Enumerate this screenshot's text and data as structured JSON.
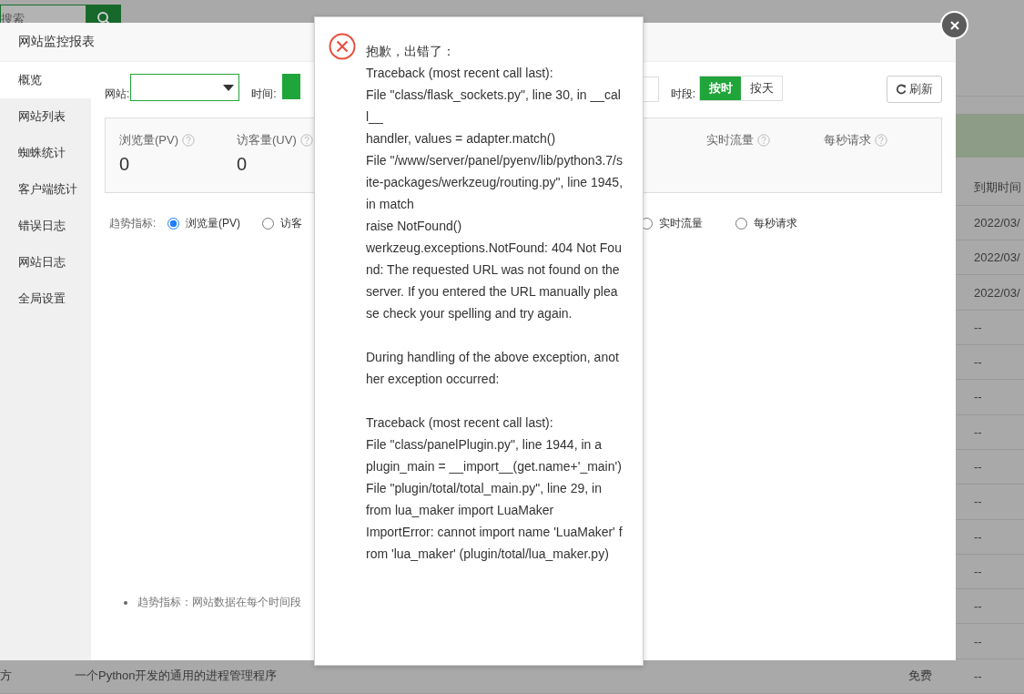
{
  "background_page": {
    "search": {
      "placeholder": "搜索"
    },
    "table": {
      "columns": [
        "到期时间"
      ],
      "rows": [
        {
          "expiry": "2022/03/"
        },
        {
          "expiry": "2022/03/"
        },
        {
          "expiry": "2022/03/"
        },
        {
          "expiry": "--"
        },
        {
          "expiry": "--"
        },
        {
          "expiry": "--"
        },
        {
          "expiry": "--"
        },
        {
          "expiry": "--"
        },
        {
          "expiry": "--"
        },
        {
          "expiry": "--"
        },
        {
          "expiry": "--"
        },
        {
          "expiry": "--"
        },
        {
          "expiry": "--"
        },
        {
          "name": "方",
          "description": "一个Python开发的通用的进程管理程序",
          "price": "免费",
          "expiry": "--"
        }
      ]
    }
  },
  "modal": {
    "title": "网站监控报表",
    "sidebar": {
      "items": [
        {
          "label": "概览",
          "selected": true
        },
        {
          "label": "网站列表",
          "selected": false
        },
        {
          "label": "蜘蛛统计",
          "selected": false
        },
        {
          "label": "客户端统计",
          "selected": false
        },
        {
          "label": "错误日志",
          "selected": false
        },
        {
          "label": "网站日志",
          "selected": false
        },
        {
          "label": "全局设置",
          "selected": false
        }
      ]
    },
    "toolbar": {
      "site_label": "网站:",
      "time_label": "时间:",
      "period_label": "时段:",
      "period_options": [
        {
          "label": "按时",
          "selected": true
        },
        {
          "label": "按天",
          "selected": false
        }
      ],
      "refresh_button": "刷新"
    },
    "stats": [
      {
        "label": "浏览量(PV)",
        "value": "0"
      },
      {
        "label": "访客量(UV)",
        "value": "0"
      },
      {
        "label": "实时流量"
      },
      {
        "label": "每秒请求"
      }
    ],
    "trend": {
      "label": "趋势指标:",
      "options": [
        {
          "label": "浏览量(PV)",
          "selected": true
        },
        {
          "label": "访客",
          "selected": false
        },
        {
          "label": "实时流量",
          "selected": false
        },
        {
          "label": "每秒请求",
          "selected": false
        }
      ]
    },
    "note": "趋势指标：网站数据在每个时间段"
  },
  "error_dialog": {
    "blocks": [
      [
        "抱歉，出错了：",
        "Traceback (most recent call last):",
        "File \"class/flask_sockets.py\", line 30, in __call__",
        "handler, values = adapter.match()",
        "File \"/www/server/panel/pyenv/lib/python3.7/site-packages/werkzeug/routing.py\", line 1945, in match",
        "raise NotFound()",
        "werkzeug.exceptions.NotFound: 404 Not Found: The requested URL was not found on the server. If you entered the URL manually please check your spelling and try again."
      ],
      [
        "During handling of the above exception, another exception occurred:"
      ],
      [
        "Traceback (most recent call last):",
        "File \"class/panelPlugin.py\", line 1944, in a",
        "plugin_main = __import__(get.name+'_main')",
        "File \"plugin/total/total_main.py\", line 29, in",
        "from lua_maker import LuaMaker",
        "ImportError: cannot import name 'LuaMaker' from 'lua_maker' (plugin/total/lua_maker.py)"
      ]
    ]
  }
}
